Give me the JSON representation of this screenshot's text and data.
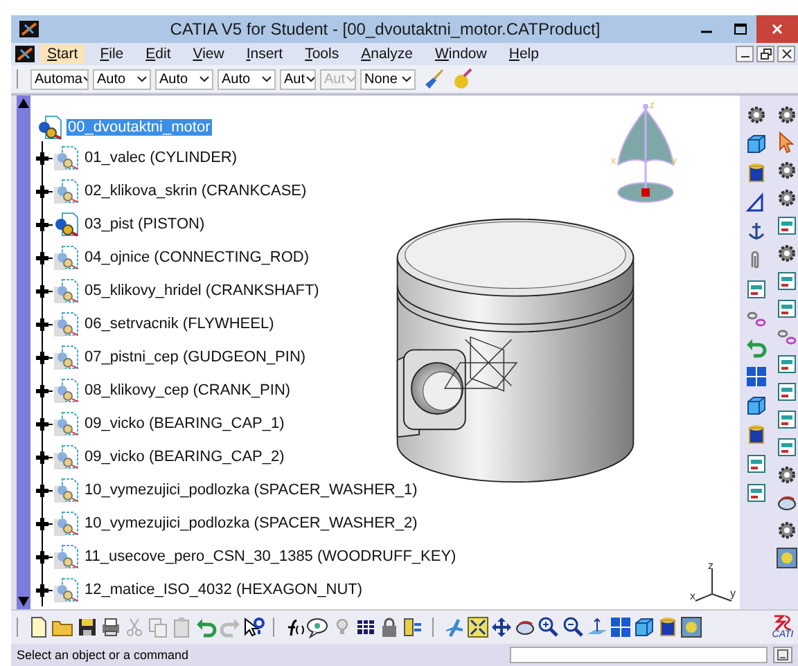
{
  "window": {
    "title": "CATIA V5 for Student - [00_dvoutaktni_motor.CATProduct]"
  },
  "menu": [
    {
      "label": "Start",
      "selected": true
    },
    {
      "label": "File",
      "selected": false
    },
    {
      "label": "Edit",
      "selected": false
    },
    {
      "label": "View",
      "selected": false
    },
    {
      "label": "Insert",
      "selected": false
    },
    {
      "label": "Tools",
      "selected": false
    },
    {
      "label": "Analyze",
      "selected": false
    },
    {
      "label": "Window",
      "selected": false
    },
    {
      "label": "Help",
      "selected": false
    }
  ],
  "combos": [
    {
      "value": "Automa",
      "disabled": false
    },
    {
      "value": "Auto",
      "disabled": false
    },
    {
      "value": "Auto",
      "disabled": false
    },
    {
      "value": "Auto",
      "disabled": false
    },
    {
      "value": "Aut",
      "disabled": false
    },
    {
      "value": "Aut",
      "disabled": true
    },
    {
      "value": "None",
      "disabled": false
    }
  ],
  "tree": {
    "label": "00_dvoutaktni_motor",
    "kind": "product",
    "selected": true,
    "expanded": true,
    "children": [
      {
        "label": "01_valec (CYLINDER)",
        "kind": "part",
        "expanded": false
      },
      {
        "label": "02_klikova_skrin (CRANKCASE)",
        "kind": "part",
        "expanded": false
      },
      {
        "label": "03_pist (PISTON)",
        "kind": "product",
        "expanded": false
      },
      {
        "label": "04_ojnice (CONNECTING_ROD)",
        "kind": "part",
        "expanded": false
      },
      {
        "label": "05_klikovy_hridel (CRANKSHAFT)",
        "kind": "part",
        "expanded": false
      },
      {
        "label": "06_setrvacnik (FLYWHEEL)",
        "kind": "part",
        "expanded": false
      },
      {
        "label": "07_pistni_cep (GUDGEON_PIN)",
        "kind": "part",
        "expanded": false
      },
      {
        "label": "08_klikovy_cep (CRANK_PIN)",
        "kind": "part",
        "expanded": false
      },
      {
        "label": "09_vicko (BEARING_CAP_1)",
        "kind": "part",
        "expanded": false
      },
      {
        "label": "09_vicko (BEARING_CAP_2)",
        "kind": "part",
        "expanded": false
      },
      {
        "label": "10_vymezujici_podlozka (SPACER_WASHER_1)",
        "kind": "part",
        "expanded": false
      },
      {
        "label": "10_vymezujici_podlozka (SPACER_WASHER_2)",
        "kind": "part",
        "expanded": false
      },
      {
        "label": "11_usecove_pero_CSN_30_1385 (WOODRUFF_KEY)",
        "kind": "part",
        "expanded": false
      },
      {
        "label": "12_matice_ISO_4032 (HEXAGON_NUT)",
        "kind": "part",
        "expanded": false
      }
    ]
  },
  "compass": {
    "labels": [
      "z",
      "x",
      "y"
    ]
  },
  "axis_triad": {
    "labels": [
      "z",
      "x",
      "y"
    ]
  },
  "brand_logo": {
    "text": "CATI"
  },
  "status_bar": {
    "message": "Select an object or a command"
  }
}
